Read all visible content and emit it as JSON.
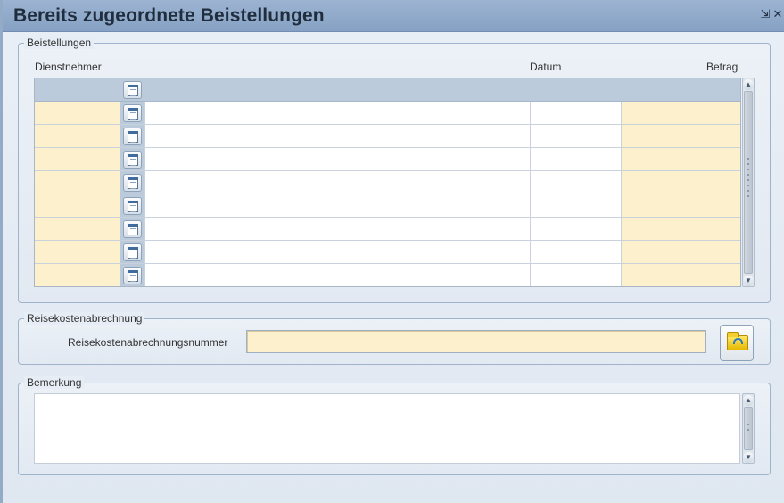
{
  "window": {
    "title": "Bereits zugeordnete Beistellungen",
    "minimize_icon": "minimize-icon",
    "close_icon": "close-icon"
  },
  "beistellungen": {
    "legend": "Beistellungen",
    "columns": {
      "dienstnehmer": "Dienstnehmer",
      "datum": "Datum",
      "betrag": "Betrag"
    },
    "row_icon": "document-icon",
    "rows": [
      {
        "dienstnehmer": "",
        "text": "",
        "datum": "",
        "betrag": ""
      },
      {
        "dienstnehmer": "",
        "text": "",
        "datum": "",
        "betrag": ""
      },
      {
        "dienstnehmer": "",
        "text": "",
        "datum": "",
        "betrag": ""
      },
      {
        "dienstnehmer": "",
        "text": "",
        "datum": "",
        "betrag": ""
      },
      {
        "dienstnehmer": "",
        "text": "",
        "datum": "",
        "betrag": ""
      },
      {
        "dienstnehmer": "",
        "text": "",
        "datum": "",
        "betrag": ""
      },
      {
        "dienstnehmer": "",
        "text": "",
        "datum": "",
        "betrag": ""
      },
      {
        "dienstnehmer": "",
        "text": "",
        "datum": "",
        "betrag": ""
      }
    ]
  },
  "reisekosten": {
    "legend": "Reisekostenabrechnung",
    "label": "Reisekostenabrechnungsnummer",
    "value": "",
    "open_icon": "folder-open-icon"
  },
  "bemerkung": {
    "legend": "Bemerkung",
    "value": ""
  },
  "colors": {
    "titlebar": "#8ea8c8",
    "required_field": "#fdf1cd",
    "grid_header": "#bccbdb"
  }
}
